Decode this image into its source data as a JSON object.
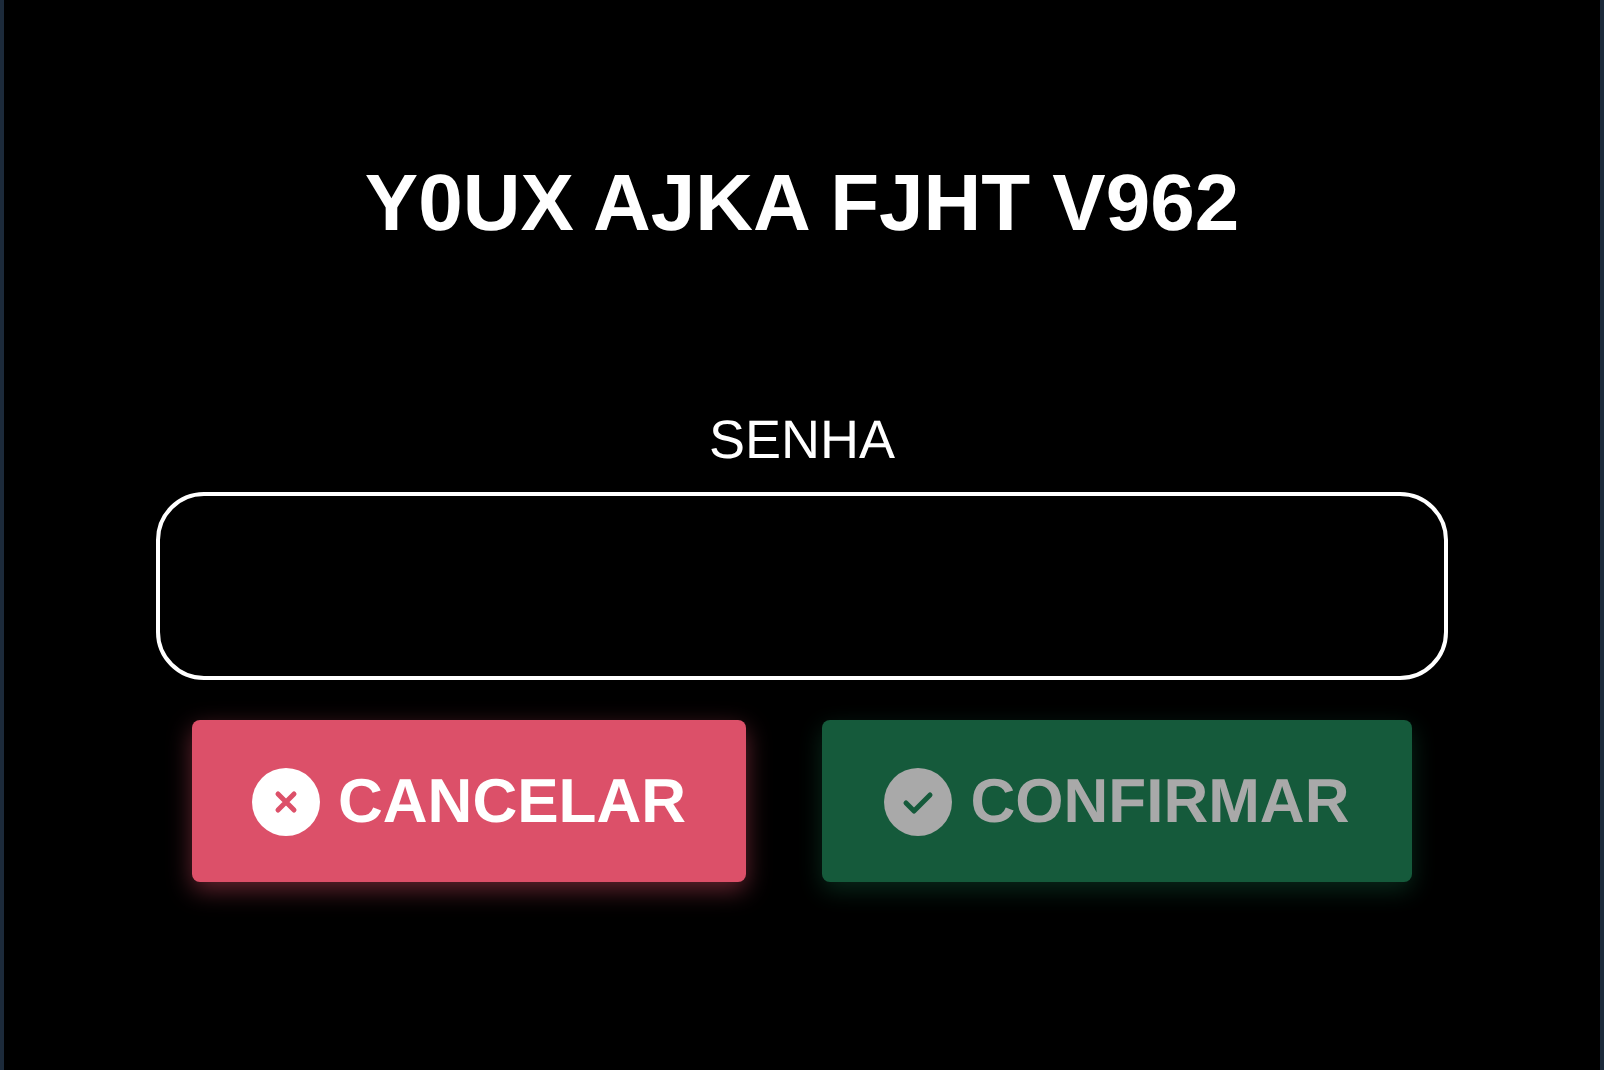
{
  "title": "Y0UX AJKA FJHT V962",
  "password": {
    "label": "SENHA"
  },
  "buttons": [
    {
      "label": "CANCELAR",
      "kind": "cancel",
      "disabled": false
    },
    {
      "label": "CONFIRMAR",
      "kind": "confirm",
      "disabled": true
    }
  ]
}
